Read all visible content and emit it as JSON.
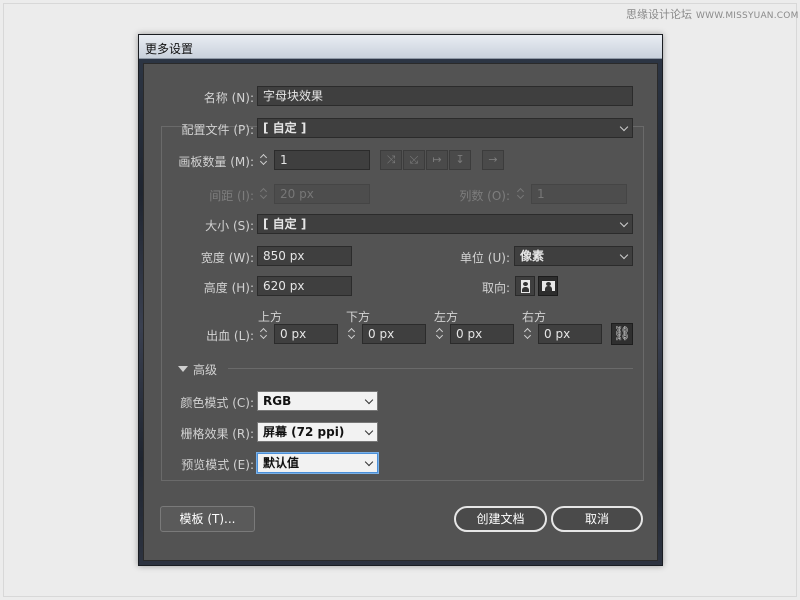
{
  "watermark": {
    "text": "思缘设计论坛",
    "url": "WWW.MISSYUAN.COM"
  },
  "dialog": {
    "title": "更多设置",
    "name": {
      "label": "名称 (N):",
      "value": "字母块效果"
    },
    "profile": {
      "label": "配置文件 (P):",
      "value": "[ 自定 ]"
    },
    "artboards": {
      "label": "画板数量 (M):",
      "value": "1",
      "icons": [
        "grid-by-row-icon",
        "grid-by-column-icon",
        "arrange-by-row-icon",
        "arrange-by-column-icon",
        "change-to-rtl-icon"
      ]
    },
    "spacing": {
      "label": "间距 (I):",
      "value": "20 px"
    },
    "columns": {
      "label": "列数 (O):",
      "value": "1"
    },
    "size": {
      "label": "大小 (S):",
      "value": "[ 自定 ]"
    },
    "width": {
      "label": "宽度 (W):",
      "value": "850 px"
    },
    "units": {
      "label": "单位 (U):",
      "value": "像素"
    },
    "height": {
      "label": "高度 (H):",
      "value": "620 px"
    },
    "orientation": {
      "label": "取向:",
      "selected": "landscape"
    },
    "bleed": {
      "label": "出血 (L):",
      "fields": [
        {
          "label": "上方",
          "value": "0 px"
        },
        {
          "label": "下方",
          "value": "0 px"
        },
        {
          "label": "左方",
          "value": "0 px"
        },
        {
          "label": "右方",
          "value": "0 px"
        }
      ]
    },
    "advanced": {
      "label": "高级"
    },
    "color_mode": {
      "label": "颜色模式 (C):",
      "value": "RGB"
    },
    "raster_effects": {
      "label": "栅格效果 (R):",
      "value": "屏幕 (72 ppi)"
    },
    "preview_mode": {
      "label": "预览模式 (E):",
      "value": "默认值"
    },
    "buttons": {
      "templates": "模板 (T)...",
      "create": "创建文档",
      "cancel": "取消"
    }
  }
}
